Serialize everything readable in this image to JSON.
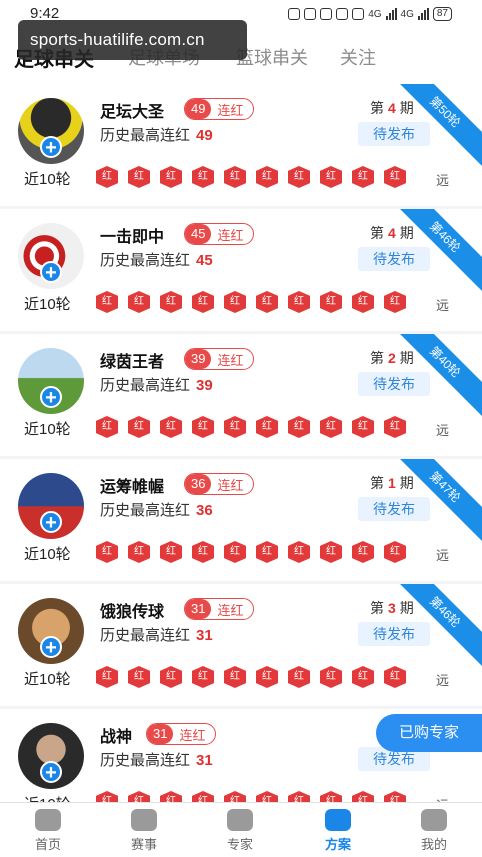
{
  "status_bar": {
    "time": "9:42",
    "network": "4G",
    "battery": "87"
  },
  "watermark": "sports-huatilife.com.cn",
  "tabs": [
    {
      "label": "足球串关",
      "active": true
    },
    {
      "label": "足球单场",
      "active": false
    },
    {
      "label": "篮球串关",
      "active": false
    },
    {
      "label": "关注",
      "active": false
    }
  ],
  "labels": {
    "streak_suffix": "连红",
    "history_prefix": "历史最高连红",
    "period_prefix": "第",
    "period_suffix": "期",
    "pending": "待发布",
    "recent": "近10轮",
    "badge": "红",
    "far": "远"
  },
  "experts": [
    {
      "name": "足坛大圣",
      "streak": "49",
      "history": "49",
      "period": "4",
      "round": "第50轮"
    },
    {
      "name": "一击即中",
      "streak": "45",
      "history": "45",
      "period": "4",
      "round": "第46轮"
    },
    {
      "name": "绿茵王者",
      "streak": "39",
      "history": "39",
      "period": "2",
      "round": "第40轮"
    },
    {
      "name": "运筹帷幄",
      "streak": "36",
      "history": "36",
      "period": "1",
      "round": "第47轮"
    },
    {
      "name": "饿狼传球",
      "streak": "31",
      "history": "31",
      "period": "3",
      "round": "第46轮"
    },
    {
      "name": "战神",
      "streak": "31",
      "history": "31",
      "period": "",
      "round": ""
    }
  ],
  "float_button": "已购专家",
  "bottom_nav": [
    {
      "label": "首页",
      "icon": "home-icon",
      "active": false
    },
    {
      "label": "赛事",
      "icon": "trophy-icon",
      "active": false
    },
    {
      "label": "专家",
      "icon": "expert-icon",
      "active": false
    },
    {
      "label": "方案",
      "icon": "plan-icon",
      "active": true
    },
    {
      "label": "我的",
      "icon": "profile-icon",
      "active": false
    }
  ],
  "colors": {
    "accent": "#1a87e8",
    "red": "#e23a3a"
  }
}
